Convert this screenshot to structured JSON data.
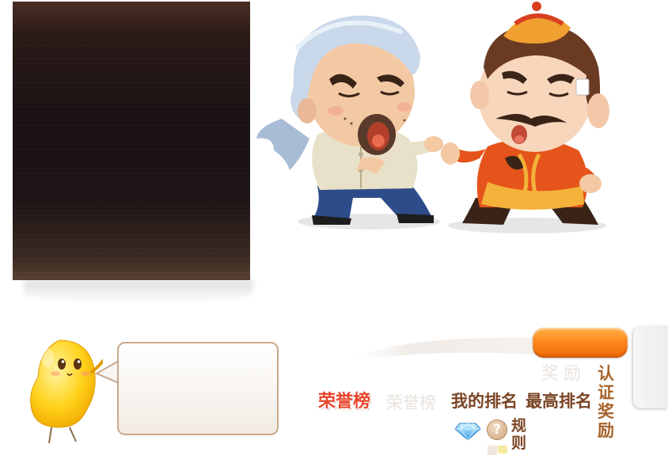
{
  "scene": {
    "characters": [
      "farmer-character",
      "nobleman-character"
    ]
  },
  "leaderboard": {
    "reward_label": "奖励",
    "cert_reward": "认证奖励",
    "tabs": {
      "honor": "荣誉榜",
      "honor_inactive": "荣誉榜",
      "my_rank": "我的排名",
      "highest_rank": "最高排名"
    },
    "rules_label": "规则",
    "help_symbol": "?",
    "icons": {
      "gem": "diamond-gem-icon",
      "help": "question-mark-icon"
    }
  },
  "mascot": {
    "name": "yellow-bean-mascot"
  },
  "colors": {
    "accent_orange": "#ff8a1e",
    "honor_red": "#e9452c",
    "tab_brown": "#7a4424",
    "panel_dark": "#1a1214"
  }
}
